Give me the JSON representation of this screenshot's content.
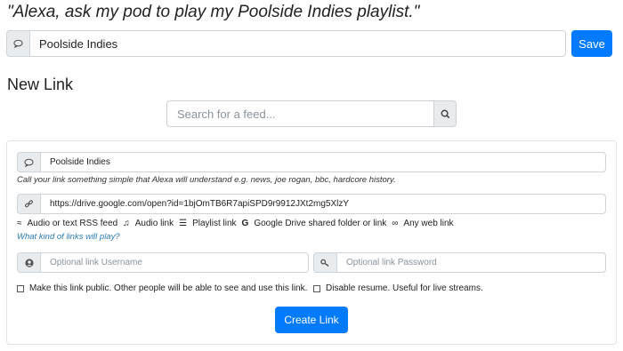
{
  "heading": "\"Alexa, ask my pod to play my Poolside Indies playlist.\"",
  "top_bar": {
    "value": "Poolside Indies",
    "save_label": "Save"
  },
  "new_link_title": "New Link",
  "search": {
    "placeholder": "Search for a feed..."
  },
  "form": {
    "name_value": "Poolside Indies",
    "name_help": "Call your link something simple that Alexa will understand e.g. news, joe rogan, bbc, hardcore history.",
    "url_value": "https://drive.google.com/open?id=1bjOmTB6R7apiSPD9r9912JXt2mg5XlzY",
    "link_types": [
      {
        "icon": "rss-icon",
        "label": "Audio or text RSS feed"
      },
      {
        "icon": "music-icon",
        "label": "Audio link"
      },
      {
        "icon": "list-icon",
        "label": "Playlist link"
      },
      {
        "icon": "google-icon",
        "label": "Google Drive shared folder or link"
      },
      {
        "icon": "link-icon",
        "label": "Any web link"
      }
    ],
    "links_help": "What kind of links will play?",
    "username_placeholder": "Optional link Username",
    "password_placeholder": "Optional link Password",
    "public_label": "Make this link public. Other people will be able to see and use this link.",
    "resume_label": "Disable resume. Useful for live streams.",
    "create_label": "Create Link"
  },
  "colors": {
    "primary": "#007bff",
    "addon_bg": "#e9ecef",
    "help_link": "#2a7ab5"
  }
}
